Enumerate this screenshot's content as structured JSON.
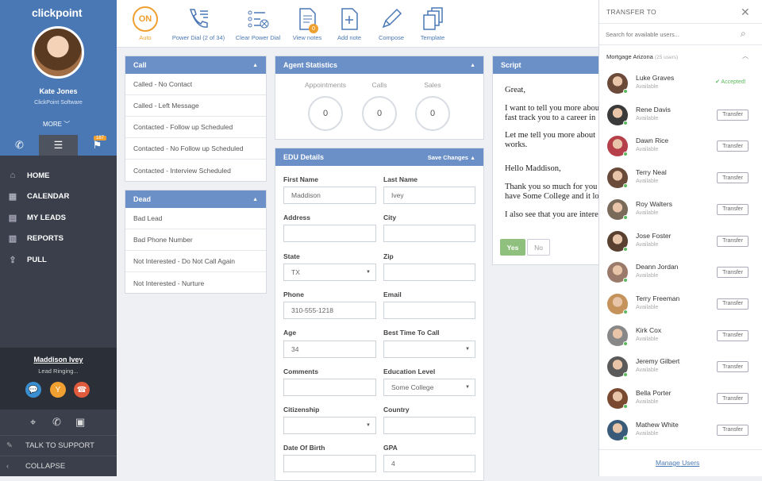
{
  "sidebar": {
    "logo": "clickpoint",
    "user_name": "Kate Jones",
    "user_company": "ClickPoint Software",
    "more_label": "MORE",
    "badge_count": "187",
    "nav": [
      {
        "label": "HOME",
        "icon": "home-icon"
      },
      {
        "label": "CALENDAR",
        "icon": "calendar-icon"
      },
      {
        "label": "MY LEADS",
        "icon": "leads-icon"
      },
      {
        "label": "REPORTS",
        "icon": "reports-icon"
      },
      {
        "label": "PULL",
        "icon": "pull-icon"
      }
    ],
    "caller": {
      "name": "Maddison Ivey",
      "status": "Lead Ringing..."
    },
    "support_label": "TALK TO SUPPORT",
    "collapse_label": "COLLAPSE"
  },
  "toolbar": {
    "on_label": "ON",
    "auto_label": "Auto",
    "power_dial": "Power Dial (2 of 34)",
    "clear_power_dial": "Clear Power Dial",
    "view_notes": "View notes",
    "notes_badge": "0",
    "add_note": "Add note",
    "compose": "Compose",
    "template": "Template"
  },
  "call_panel": {
    "title": "Call",
    "items": [
      "Called - No Contact",
      "Called - Left Message",
      "Contacted - Follow up Scheduled",
      "Contacted - No Follow up Scheduled",
      "Contacted - Interview Scheduled"
    ]
  },
  "dead_panel": {
    "title": "Dead",
    "items": [
      "Bad Lead",
      "Bad Phone Number",
      "Not Interested - Do Not Call Again",
      "Not Interested - Nurture"
    ]
  },
  "agent_stats": {
    "title": "Agent Statistics",
    "appointments_label": "Appointments",
    "appointments": "0",
    "calls_label": "Calls",
    "calls": "0",
    "sales_label": "Sales",
    "sales": "0"
  },
  "edu": {
    "title": "EDU Details",
    "save_label": "Save Changes",
    "fields": {
      "first_name": {
        "label": "First Name",
        "value": "Maddison"
      },
      "last_name": {
        "label": "Last Name",
        "value": "Ivey"
      },
      "address": {
        "label": "Address",
        "value": ""
      },
      "city": {
        "label": "City",
        "value": ""
      },
      "state": {
        "label": "State",
        "value": "TX"
      },
      "zip": {
        "label": "Zip",
        "value": ""
      },
      "phone": {
        "label": "Phone",
        "value": "310-555-1218"
      },
      "email": {
        "label": "Email",
        "value": ""
      },
      "age": {
        "label": "Age",
        "value": "34"
      },
      "best_time": {
        "label": "Best Time To Call",
        "value": ""
      },
      "comments": {
        "label": "Comments",
        "value": ""
      },
      "education": {
        "label": "Education Level",
        "value": "Some College"
      },
      "citizenship": {
        "label": "Citizenship",
        "value": ""
      },
      "country": {
        "label": "Country",
        "value": ""
      },
      "dob": {
        "label": "Date Of Birth",
        "value": ""
      },
      "gpa": {
        "label": "GPA",
        "value": "4"
      }
    }
  },
  "script": {
    "title": "Script",
    "lines": [
      "Great,",
      "I want to tell you more about",
      "fast track you to a career in",
      "Let me tell you more about",
      "works.",
      "Hello Maddison,",
      "Thank you so much for you",
      "have Some College and it lo",
      "I also see that you are intere"
    ],
    "yes_label": "Yes",
    "no_label": "No"
  },
  "transfer": {
    "title": "TRANSFER TO",
    "search_placeholder": "Search for available users...",
    "group_name": "Mortgage Arizona",
    "group_count": "(25 users)",
    "transfer_label": "Transfer",
    "accepted_label": "✔ Accepted!",
    "users": [
      {
        "name": "Luke Graves",
        "status": "Available",
        "accepted": true
      },
      {
        "name": "Rene Davis",
        "status": "Available"
      },
      {
        "name": "Dawn Rice",
        "status": "Available"
      },
      {
        "name": "Terry Neal",
        "status": "Available"
      },
      {
        "name": "Roy Walters",
        "status": "Available"
      },
      {
        "name": "Jose Foster",
        "status": "Available"
      },
      {
        "name": "Deann Jordan",
        "status": "Available"
      },
      {
        "name": "Terry Freeman",
        "status": "Available"
      },
      {
        "name": "Kirk Cox",
        "status": "Available"
      },
      {
        "name": "Jeremy Gilbert",
        "status": "Available"
      },
      {
        "name": "Bella Porter",
        "status": "Available"
      },
      {
        "name": "Mathew White",
        "status": "Available"
      }
    ],
    "manage_label": "Manage Users"
  },
  "colors": {
    "primary": "#4a78b5",
    "panel_header": "#6b8fc7",
    "accent": "#f0a030",
    "success": "#5cb85c"
  }
}
